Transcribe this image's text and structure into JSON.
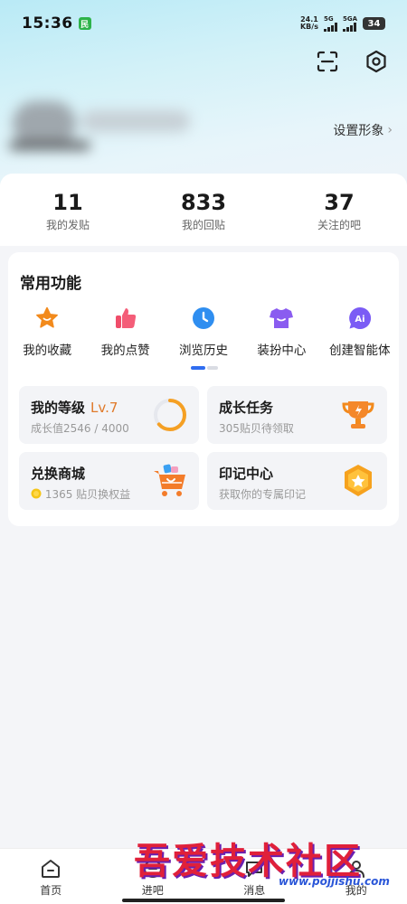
{
  "status_bar": {
    "time": "15:36",
    "app_badge": "民",
    "net_speed_value": "24.1",
    "net_speed_unit": "KB/s",
    "sim1": "5G",
    "sim2": "5GA",
    "battery": "34"
  },
  "profile": {
    "setting_look": "设置形象",
    "chevron": "›"
  },
  "stats": [
    {
      "value": "11",
      "label": "我的发贴"
    },
    {
      "value": "833",
      "label": "我的回贴"
    },
    {
      "value": "37",
      "label": "关注的吧"
    }
  ],
  "common": {
    "title": "常用功能",
    "items": [
      {
        "label": "我的收藏",
        "icon": "star-icon",
        "color": "#f28a1c"
      },
      {
        "label": "我的点赞",
        "icon": "thumbs-up-icon",
        "color": "#f04d6a"
      },
      {
        "label": "浏览历史",
        "icon": "clock-icon",
        "color": "#2f8ef0"
      },
      {
        "label": "装扮中心",
        "icon": "shirt-icon",
        "color": "#8a5cf0"
      },
      {
        "label": "创建智能体",
        "icon": "ai-icon",
        "color": "#7b5cf5"
      }
    ],
    "pager_accent": "#2f6df0"
  },
  "tiles": {
    "level": {
      "title": "我的等级",
      "level": "Lv.7",
      "sub": "成长值2546 / 4000",
      "progress": 0.6365
    },
    "growth": {
      "title": "成长任务",
      "sub": "305贴贝待领取"
    },
    "exchange": {
      "title": "兑换商城",
      "sub": "1365 贴贝换权益"
    },
    "imprint": {
      "title": "印记中心",
      "sub": "获取你的专属印记"
    }
  },
  "tabbar": [
    {
      "label": "首页",
      "icon": "home-icon"
    },
    {
      "label": "进吧",
      "icon": "enter-bar-icon"
    },
    {
      "label": "消息",
      "icon": "message-icon"
    },
    {
      "label": "我的",
      "icon": "profile-icon"
    }
  ],
  "watermark": {
    "text": "吾爱技术社区",
    "url": "www.pojjishu.com"
  }
}
